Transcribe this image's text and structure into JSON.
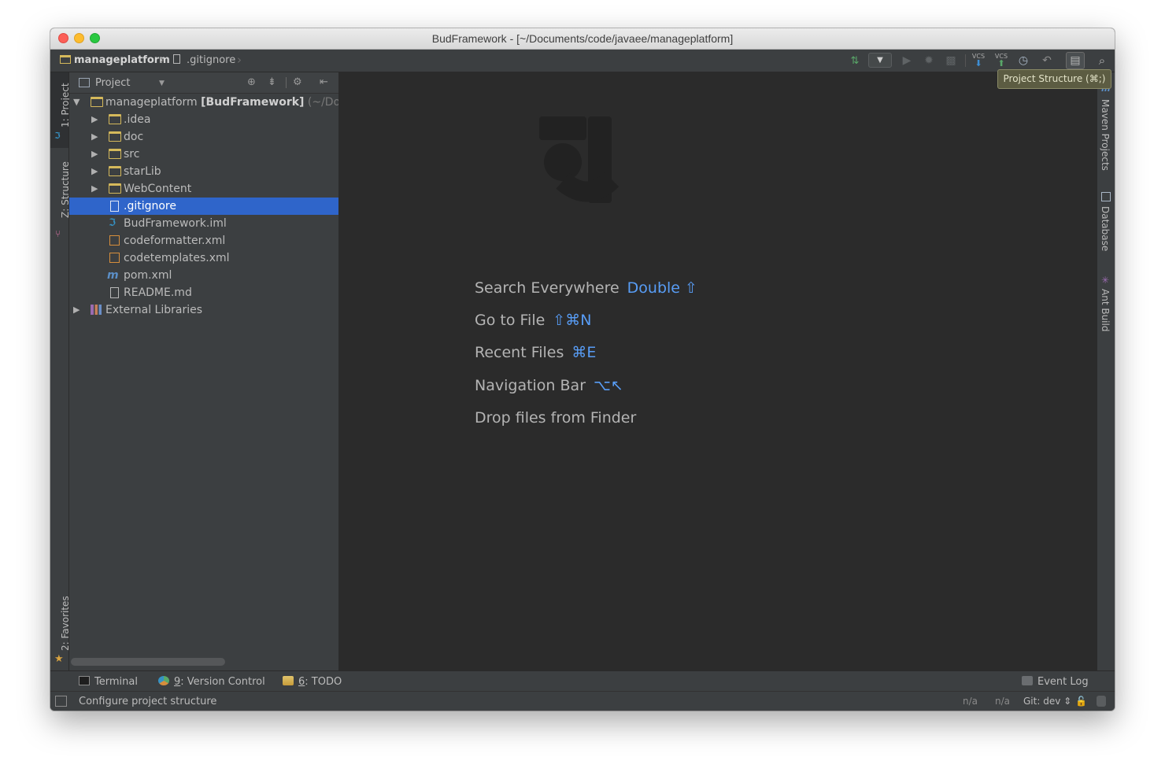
{
  "window": {
    "title": "BudFramework - [~/Documents/code/javaee/manageplatform]"
  },
  "navbar": {
    "breadcrumbs": [
      "manageplatform",
      ".gitignore"
    ],
    "vcs_update_label": "VCS",
    "vcs_commit_label": "VCS",
    "tooltip": "Project Structure (⌘;)"
  },
  "left_tabs": {
    "project": "1: Project",
    "structure": "Z: Structure",
    "favorites": "2: Favorites"
  },
  "right_tabs": {
    "maven": "Maven Projects",
    "database": "Database",
    "ant": "Ant Build"
  },
  "project_panel": {
    "title": "Project",
    "tree": [
      {
        "label": "manageplatform",
        "bold": "[BudFramework]",
        "path": "(~/Docun",
        "type": "module",
        "depth": 0,
        "expanded": true
      },
      {
        "label": ".idea",
        "type": "folder",
        "depth": 1,
        "expanded": false
      },
      {
        "label": "doc",
        "type": "folder",
        "depth": 1,
        "expanded": false
      },
      {
        "label": "src",
        "type": "folder",
        "depth": 1,
        "expanded": false
      },
      {
        "label": "starLib",
        "type": "folder",
        "depth": 1,
        "expanded": false
      },
      {
        "label": "WebContent",
        "type": "folder",
        "depth": 1,
        "expanded": false
      },
      {
        "label": ".gitignore",
        "type": "file",
        "depth": 1,
        "selected": true
      },
      {
        "label": "BudFramework.iml",
        "type": "iml",
        "depth": 1
      },
      {
        "label": "codeformatter.xml",
        "type": "xml",
        "depth": 1
      },
      {
        "label": "codetemplates.xml",
        "type": "xml",
        "depth": 1
      },
      {
        "label": "pom.xml",
        "type": "maven",
        "depth": 1
      },
      {
        "label": "README.md",
        "type": "file",
        "depth": 1
      },
      {
        "label": "External Libraries",
        "type": "libraries",
        "depth": 0,
        "expanded": false
      }
    ]
  },
  "editor": {
    "hints": [
      {
        "label": "Search Everywhere",
        "key": "Double ⇧"
      },
      {
        "label": "Go to File",
        "key": "⇧⌘N"
      },
      {
        "label": "Recent Files",
        "key": "⌘E"
      },
      {
        "label": "Navigation Bar",
        "key": "⌥↖"
      },
      {
        "label": "Drop files from Finder",
        "key": ""
      }
    ]
  },
  "bottom_tabs": {
    "terminal": "Terminal",
    "version_control_num": "9",
    "version_control": ": Version Control",
    "todo_num": "6",
    "todo": ": TODO",
    "event_log": "Event Log"
  },
  "statusbar": {
    "message": "Configure project structure",
    "na1": "n/a",
    "na2": "n/a",
    "git": "Git: dev ⇕"
  },
  "colors": {
    "accent": "#589df6",
    "selection": "#2f65ca",
    "folder": "#d5b95b",
    "background": "#2b2b2b",
    "panel": "#3c3f41"
  }
}
